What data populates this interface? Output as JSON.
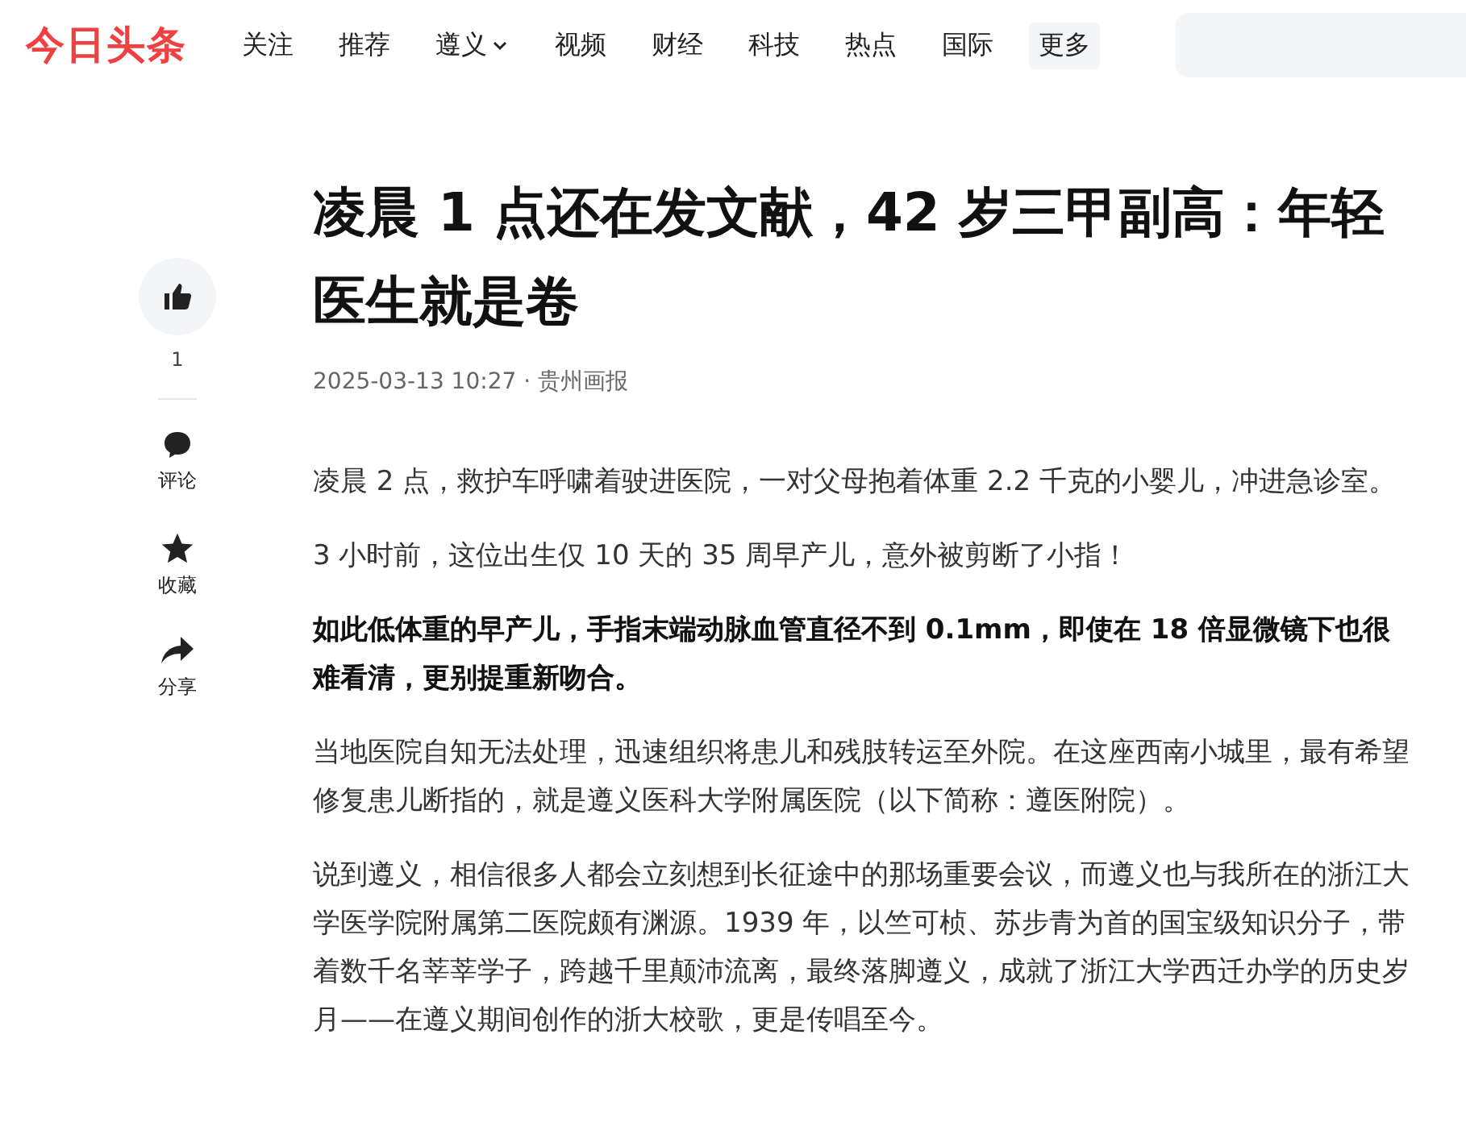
{
  "header": {
    "logo": "今日头条",
    "nav": [
      {
        "label": "关注",
        "kind": "link"
      },
      {
        "label": "推荐",
        "kind": "link"
      },
      {
        "label": "遵义",
        "kind": "dropdown"
      },
      {
        "label": "视频",
        "kind": "link"
      },
      {
        "label": "财经",
        "kind": "link"
      },
      {
        "label": "科技",
        "kind": "link"
      },
      {
        "label": "热点",
        "kind": "link"
      },
      {
        "label": "国际",
        "kind": "link"
      },
      {
        "label": "更多",
        "kind": "more"
      }
    ]
  },
  "sidebar": {
    "like_count": "1",
    "actions": [
      {
        "label": "评论",
        "kind": "comment"
      },
      {
        "label": "收藏",
        "kind": "star"
      },
      {
        "label": "分享",
        "kind": "share"
      }
    ]
  },
  "article": {
    "title": "凌晨 1 点还在发文献，42 岁三甲副高：年轻医生就是卷",
    "meta": "2025-03-13 10:27 · 贵州画报",
    "paragraphs": [
      {
        "text": "凌晨 2 点，救护车呼啸着驶进医院，一对父母抱着体重 2.2 千克的小婴儿，冲进急诊室。",
        "bold": false
      },
      {
        "text": "3 小时前，这位出生仅 10 天的 35 周早产儿，意外被剪断了小指！",
        "bold": false
      },
      {
        "text": "如此低体重的早产儿，手指末端动脉血管直径不到 0.1mm，即使在 18 倍显微镜下也很难看清，更别提重新吻合。",
        "bold": true
      },
      {
        "text": "当地医院自知无法处理，迅速组织将患儿和残肢转运至外院。在这座西南小城里，最有希望修复患儿断指的，就是遵义医科大学附属医院（以下简称：遵医附院）。",
        "bold": false
      },
      {
        "text": "说到遵义，相信很多人都会立刻想到长征途中的那场重要会议，而遵义也与我所在的浙江大学医学院附属第二医院颇有渊源。1939 年，以竺可桢、苏步青为首的国宝级知识分子，带着数千名莘莘学子，跨越千里颠沛流离，最终落脚遵义，成就了浙江大学西迁办学的历史岁月——在遵义期间创作的浙大校歌，更是传唱至今。",
        "bold": false
      }
    ]
  }
}
